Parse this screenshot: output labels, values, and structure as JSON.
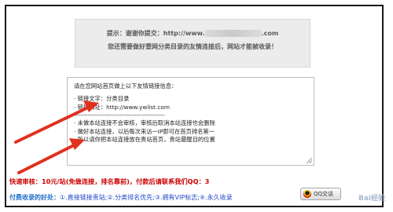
{
  "notice": {
    "line1_prefix": "提示：谢谢你提交：http://www.",
    "line1_suffix": ".com",
    "line2": "您还需要做好壹网分类目录的友情连接后，网站才能被收录！"
  },
  "link_box": {
    "heading": "请在您网站首页做上以下友情链接信息：",
    "link_text": "链接文字：分类目录",
    "link_url": "链接网址：http://www.ywlist.com",
    "divider": "------------------------------------------------------",
    "notes": [
      "未做本站连接不会审核，审核后取消本站连接也会删除",
      "做好本站连接，以后每次来访一IP即可在首页排名第一",
      "所以请你把本站连接放在贵站首页，贵站最醒目的位置"
    ]
  },
  "fast_review": "快速审核：10元/站(免做连接，排名靠前)，付款后请联系我们QQ：3",
  "benefits": {
    "label": "付费收录的好处：",
    "items": "①.直接链接贵站;②.分类排名优先;③.拥有VIP标志;④.永久收录"
  },
  "qq_button": "QQ交谈",
  "watermark": "Bai经验",
  "colors": {
    "accent_red": "#cc0000",
    "link_blue": "#1f45c8",
    "arrow_red": "#e0301e"
  }
}
